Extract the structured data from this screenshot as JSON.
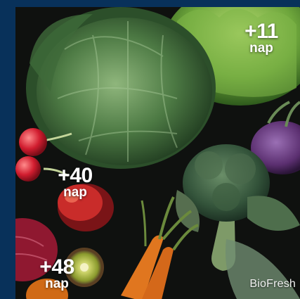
{
  "badges": [
    {
      "value": "+11",
      "unit": "nap"
    },
    {
      "value": "+40",
      "unit": "nap"
    },
    {
      "value": "+48",
      "unit": "nap"
    }
  ],
  "brand": "BioFresh",
  "colors": {
    "frame": "#08315a",
    "label": "#ffffff"
  }
}
